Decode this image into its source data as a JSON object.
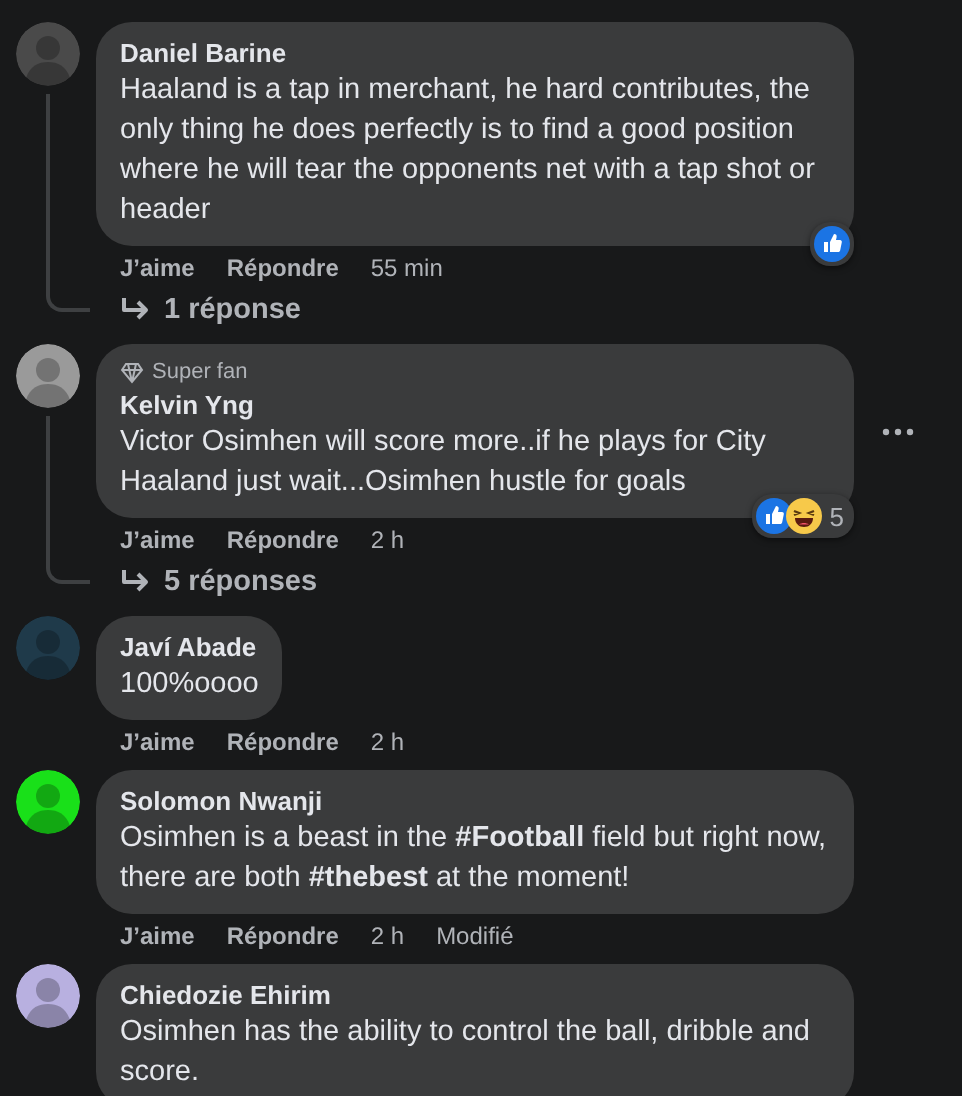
{
  "comments": [
    {
      "author": "Daniel Barine",
      "color": "#4a4a4a",
      "text": "Haaland is a tap in merchant, he hard contributes, the only thing he does perfectly is to find a good position where he will tear the opponents net with a tap shot or header",
      "like": "J’aime",
      "reply": "Répondre",
      "time": "55 min",
      "reactions": [
        {
          "kind": "like"
        }
      ],
      "replies": "1 réponse",
      "more_menu": false
    },
    {
      "badge": "Super fan",
      "author": "Kelvin Yng",
      "color": "#9a9a9a",
      "text": "Victor Osimhen will score more..if he plays for City Haaland just wait...Osimhen hustle for goals",
      "like": "J’aime",
      "reply": "Répondre",
      "time": "2 h",
      "reactions": [
        {
          "kind": "like"
        },
        {
          "kind": "haha"
        }
      ],
      "reaction_count": "5",
      "replies": "5 réponses",
      "more_menu": true
    },
    {
      "author": "Javí Abade",
      "color": "#1f3a4a",
      "text": "100%oooo",
      "like": "J’aime",
      "reply": "Répondre",
      "time": "2 h",
      "more_menu": false
    },
    {
      "author": "Solomon Nwanji",
      "color": "#19e019",
      "text": "Osimhen is a beast in the **#Football** field but right now, there are both **#thebest** at the moment!",
      "like": "J’aime",
      "reply": "Répondre",
      "time": "2 h",
      "edited": "Modifié",
      "more_menu": false
    },
    {
      "author": "Chiedozie Ehirim",
      "color": "#b8b0e0",
      "text": "Osimhen has the ability to control the ball, dribble and score.",
      "more_menu": false
    }
  ]
}
